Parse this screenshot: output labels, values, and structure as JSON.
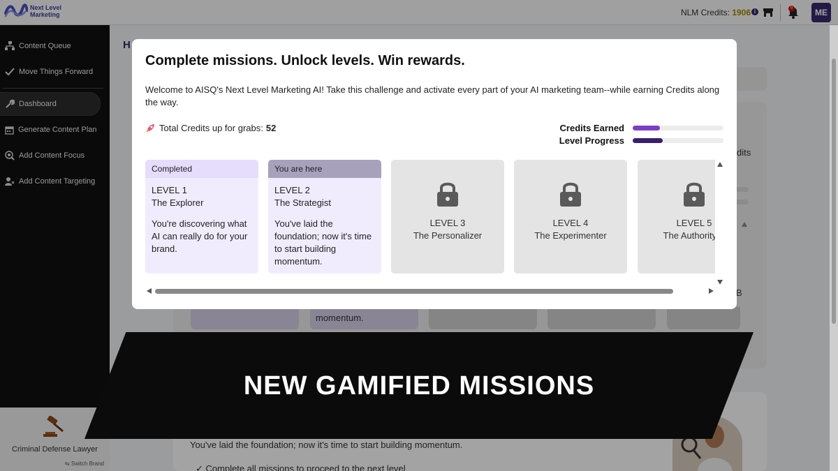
{
  "topbar": {
    "logo_line1": "Next Level",
    "logo_line2": "Marketing",
    "credits_label": "NLM Credits:",
    "credits_value": "1906",
    "notification_count": "0",
    "avatar_initials": "ME"
  },
  "sidebar": {
    "items": [
      {
        "label": "Content Queue",
        "icon": "hierarchy-icon"
      },
      {
        "label": "Move Things Forward",
        "icon": "check-icon"
      },
      {
        "label": "Dashboard",
        "icon": "wrench-icon"
      },
      {
        "label": "Generate Content Plan",
        "icon": "calendar-icon"
      },
      {
        "label": "Add Content Focus",
        "icon": "target-icon"
      },
      {
        "label": "Add Content Targeting",
        "icon": "users-icon"
      }
    ],
    "brand_name": "Criminal Defense Lawyer",
    "switch_brand": "Switch Brand"
  },
  "background": {
    "heading_fragment": "H",
    "credits_fragment": "dits",
    "level_fragment": "B",
    "card_text": "momentum.",
    "bottom_text1": "You've laid the foundation; now it's time to start building momentum.",
    "bottom_text2": "Complete all missions to proceed to the next level"
  },
  "modal": {
    "title": "Complete missions. Unlock levels. Win rewards.",
    "description": "Welcome to AISQ's Next Level Marketing AI! Take this challenge and activate every part of your AI marketing team--while earning Credits along the way.",
    "total_label": "Total Credits up for grabs:",
    "total_value": "52",
    "credits_earned_label": "Credits Earned",
    "credits_earned_fraction": 0.3,
    "level_progress_label": "Level Progress",
    "level_progress_fraction": 0.33,
    "colors": {
      "credits_bar": "#7b3fc4",
      "level_bar": "#3b1f6e"
    },
    "levels": [
      {
        "status": "Completed",
        "level": "LEVEL 1",
        "name": "The Explorer",
        "description": "You're discovering what AI can really do for your brand."
      },
      {
        "status": "You are here",
        "level": "LEVEL 2",
        "name": "The Strategist",
        "description": "You've laid the foundation; now it's time to start building momentum."
      },
      {
        "level": "LEVEL 3",
        "name": "The Personalizer"
      },
      {
        "level": "LEVEL 4",
        "name": "The Experimenter"
      },
      {
        "level": "LEVEL 5",
        "name": "The Authority B"
      }
    ]
  },
  "banner": {
    "text": "NEW GAMIFIED MISSIONS"
  }
}
